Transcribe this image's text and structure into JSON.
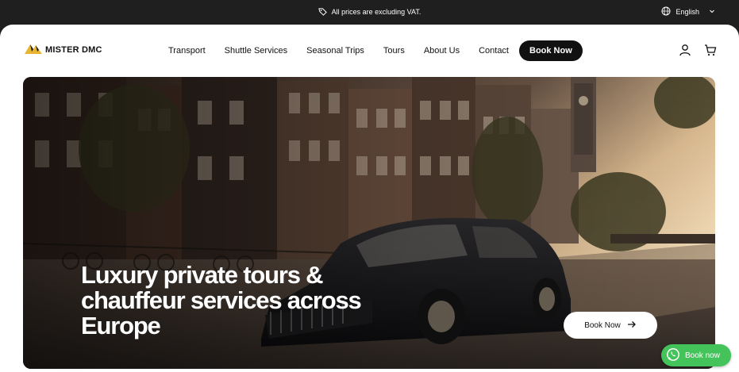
{
  "topbar": {
    "notice": "All prices are excluding VAT.",
    "language": "English"
  },
  "brand": {
    "name": "MISTER DMC"
  },
  "nav": {
    "items": [
      {
        "label": "Transport"
      },
      {
        "label": "Shuttle Services"
      },
      {
        "label": "Seasonal Trips"
      },
      {
        "label": "Tours"
      },
      {
        "label": "About Us"
      },
      {
        "label": "Contact"
      }
    ],
    "book_label": "Book Now"
  },
  "hero": {
    "title_lines": [
      "Luxury private tours &",
      "chauffeur services across",
      "Europe"
    ],
    "cta_label": "Book Now"
  },
  "whatsapp": {
    "label": "Book now"
  },
  "colors": {
    "dark": "#1f1f1f",
    "accent_gold": "#e8b530",
    "whatsapp_green": "#43c35a"
  },
  "icons": [
    "tag-icon",
    "globe-icon",
    "chevron-down-icon",
    "user-icon",
    "cart-icon",
    "arrow-right-icon",
    "whatsapp-icon"
  ]
}
